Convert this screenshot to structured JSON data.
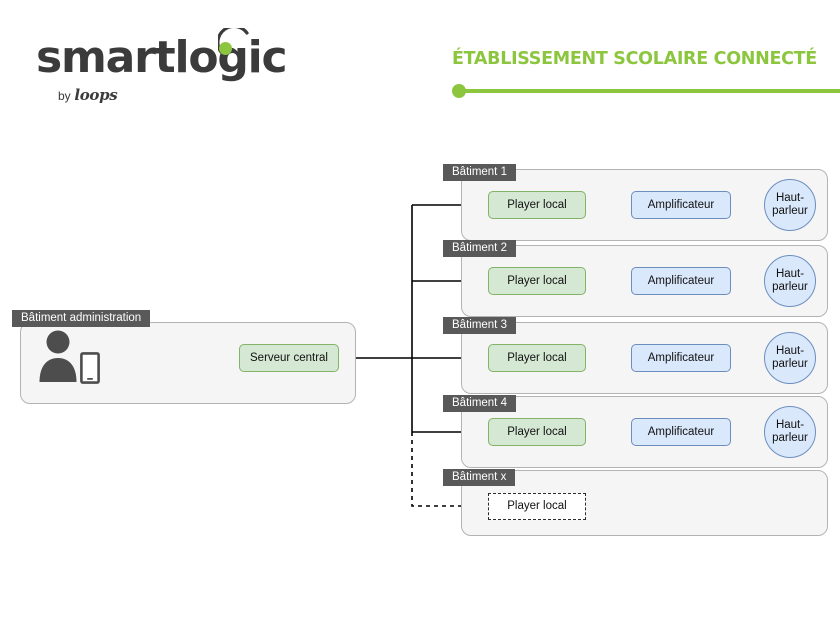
{
  "header": {
    "logo": {
      "wordmark": "smartlogic",
      "byline_prefix": "by",
      "byline_brand": "loops",
      "dot_name": "logo-green-dot",
      "arc_name": "logo-signal-arc"
    },
    "title": "ÉTABLISSEMENT SCOLAIRE CONNECTÉ",
    "accent_color": "#8cc63e"
  },
  "diagram": {
    "admin": {
      "label": "Bâtiment administration",
      "person_icon": "person-icon",
      "phone_icon": "smartphone-icon",
      "server": {
        "label": "Serveur central",
        "style": "green"
      }
    },
    "buildings": [
      {
        "label": "Bâtiment 1",
        "player": "Player local",
        "amplifier": "Amplificateur",
        "speaker": "Haut-parleur",
        "speaker_line1": "Haut-",
        "speaker_line2": "parleur",
        "dashed": false
      },
      {
        "label": "Bâtiment 2",
        "player": "Player local",
        "amplifier": "Amplificateur",
        "speaker": "Haut-parleur",
        "speaker_line1": "Haut-",
        "speaker_line2": "parleur",
        "dashed": false
      },
      {
        "label": "Bâtiment 3",
        "player": "Player local",
        "amplifier": "Amplificateur",
        "speaker": "Haut-parleur",
        "speaker_line1": "Haut-",
        "speaker_line2": "parleur",
        "dashed": false
      },
      {
        "label": "Bâtiment 4",
        "player": "Player local",
        "amplifier": "Amplificateur",
        "speaker": "Haut-parleur",
        "speaker_line1": "Haut-",
        "speaker_line2": "parleur",
        "dashed": false
      },
      {
        "label": "Bâtiment x",
        "player": "Player local",
        "amplifier": "",
        "speaker": "",
        "speaker_line1": "",
        "speaker_line2": "",
        "dashed": true
      }
    ],
    "colors": {
      "node_green_fill": "#d5e8d4",
      "node_green_border": "#82b366",
      "node_blue_fill": "#dae8fc",
      "node_blue_border": "#6c8ebf",
      "group_fill": "#f5f5f5",
      "group_border": "#b3b3b3",
      "label_tab_fill": "#595959",
      "connector": "#000000",
      "person_fill": "#4d4d4d"
    }
  }
}
